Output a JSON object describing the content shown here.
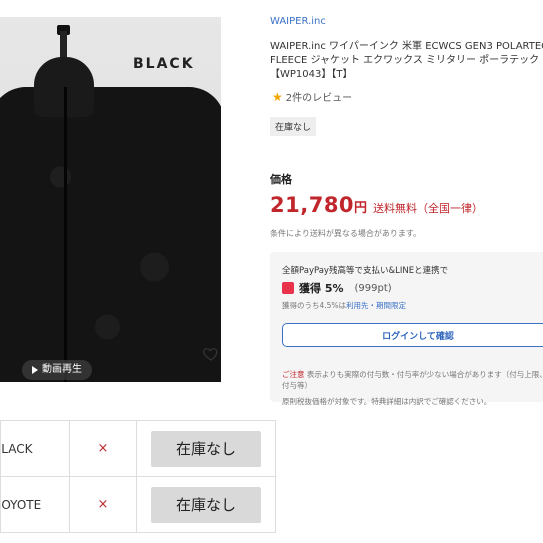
{
  "product_image": {
    "overlay_label": "BLACK",
    "video_button_label": "動画再生",
    "favorite_icon": "heart-icon",
    "video_icon": "play-icon"
  },
  "brand": "WAIPER.inc",
  "title": "WAIPER.inc ワイパーインク 米軍 ECWCS GEN3 POLARTEC FLEECE ジャケット エクワックス ミリタリー ポーラテック【WP1043】【T】",
  "review": {
    "star_icon": "star-icon",
    "label": "2件のレビュー"
  },
  "stock_badge": "在庫なし",
  "price_section": {
    "label": "価格",
    "price": "21,780",
    "currency": "円",
    "shipping": "送料無料（全国一律）",
    "note": "条件により送料が異なる場合があります。"
  },
  "paypay": {
    "heading": "全額PayPay残高等で支払い&LINEと連携で",
    "earn_label": "獲得 5%",
    "points": "(999pt)",
    "sub_prefix": "獲得のうち4.5%は",
    "sub_link": "利用先・期間限定",
    "login_button": "ログインして確認",
    "caution_head": "ご注意",
    "caution_text": "表示よりも実際の付与数・付与率が少ない場合があります（付与上限、付与等）",
    "bottom_text": "原則税抜価格が対象です。特典詳細は内訳でご確認ください。"
  },
  "variations": {
    "rows": [
      {
        "name": "BLACK",
        "mark": "×",
        "stock": "在庫なし"
      },
      {
        "name": "COYOTE",
        "mark": "×",
        "stock": "在庫なし"
      }
    ]
  },
  "colors": {
    "price_red": "#c0262c",
    "link_blue": "#3a71c6",
    "star": "#f2a600",
    "paypay_red": "#e8334a"
  }
}
